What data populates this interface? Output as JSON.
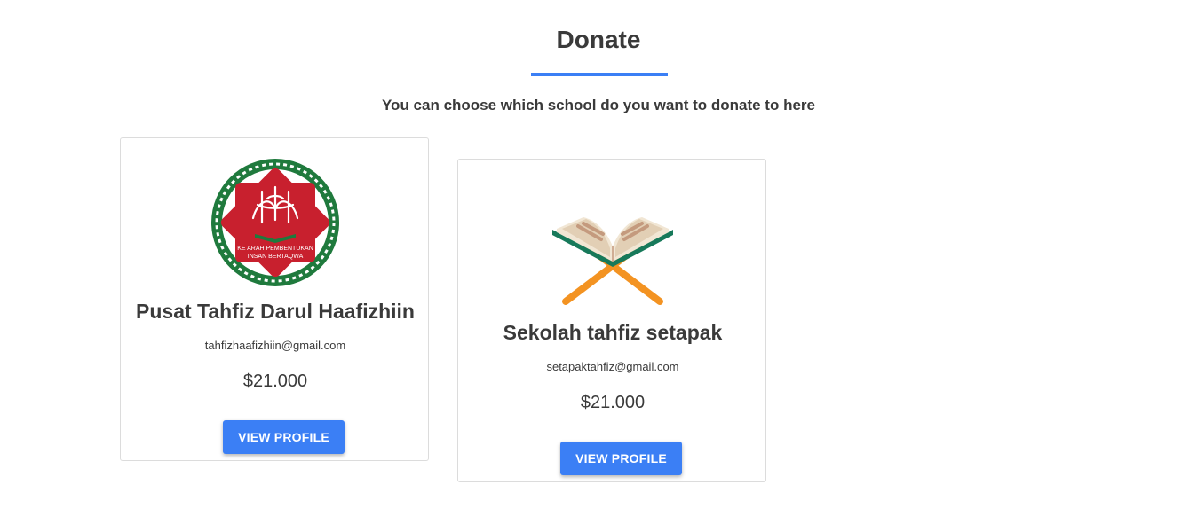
{
  "page": {
    "title": "Donate",
    "subtitle": "You can choose which school do you want to donate to here",
    "accent_color": "#3b7ff5"
  },
  "schools": [
    {
      "name": "Pusat Tahfiz Darul Haafizhiin",
      "email": "tahfizhaafizhiin@gmail.com",
      "amount": "$21.000",
      "button_label": "VIEW PROFILE",
      "logo": "darul-haafizhiin-emblem",
      "logo_text_line1": "KE ARAH PEMBENTUKAN",
      "logo_text_line2": "INSAN BERTAQWA"
    },
    {
      "name": "Sekolah tahfiz setapak",
      "email": "setapaktahfiz@gmail.com",
      "amount": "$21.000",
      "button_label": "VIEW PROFILE",
      "logo": "quran-on-stand-icon"
    }
  ]
}
